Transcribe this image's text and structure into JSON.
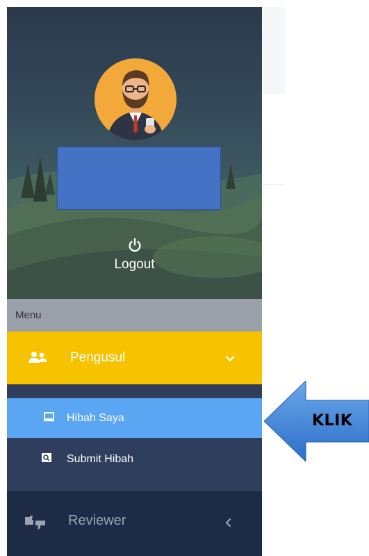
{
  "profile": {
    "logout_label": "Logout",
    "logout_icon": "power-icon"
  },
  "menu": {
    "header": "Menu",
    "items": [
      {
        "label": "Pengusul",
        "icon": "users-icon",
        "expanded": true,
        "background": "#f7c200",
        "children": [
          {
            "label": "Hibah Saya",
            "icon": "monitor-icon",
            "active": true,
            "background": "#5aa6f3"
          },
          {
            "label": "Submit Hibah",
            "icon": "search-box-icon",
            "active": false
          }
        ]
      },
      {
        "label": "Reviewer",
        "icon": "thumbs-icon",
        "expanded": false,
        "background": "#1e2b47"
      }
    ]
  },
  "annotation": {
    "label": "KLIK",
    "arrow_color": "#3a7ed6"
  },
  "colors": {
    "sidebar_bg": "#2e3e5c",
    "menu_header_bg": "#9aa0a9",
    "accent_yellow": "#f7c200",
    "active_blue": "#5aa6f3",
    "redaction_box": "#4472c4"
  }
}
